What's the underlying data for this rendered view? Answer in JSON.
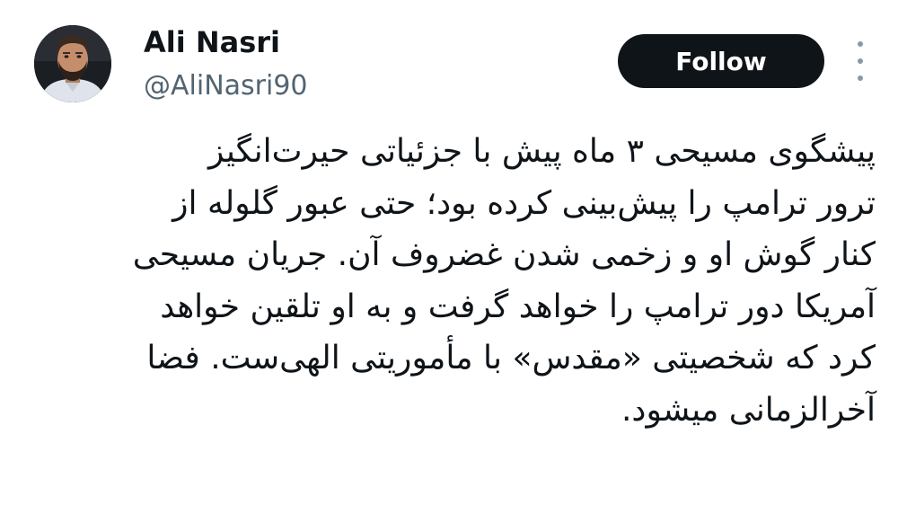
{
  "author": {
    "name": "Ali Nasri",
    "handle": "@AliNasri90"
  },
  "follow_button": {
    "label": "Follow"
  },
  "icons": {
    "avatar": "profile-photo",
    "more": "more-vertical-icon"
  },
  "colors": {
    "text": "#0f1419",
    "secondary": "#536471",
    "follow_bg": "#0f1419",
    "follow_text": "#ffffff"
  },
  "tweet": {
    "lines": [
      "پیشگوی مسیحی ۳ ماه پیش با جزئیاتی حیرت‌انگیز",
      "ترور ترامپ را پیش‌بینی کرده بود؛ حتی عبور گلوله از",
      "کنار گوش او و زخمی شدن غضروف آن. جریان مسیحی",
      "آمریکا دور ترامپ را خواهد گرفت و به او تلقین خواهد",
      "کرد که شخصیتی «مقدس» با مأموریتی الهی‌ست. فضا",
      "آخرالزمانی میشود."
    ]
  }
}
